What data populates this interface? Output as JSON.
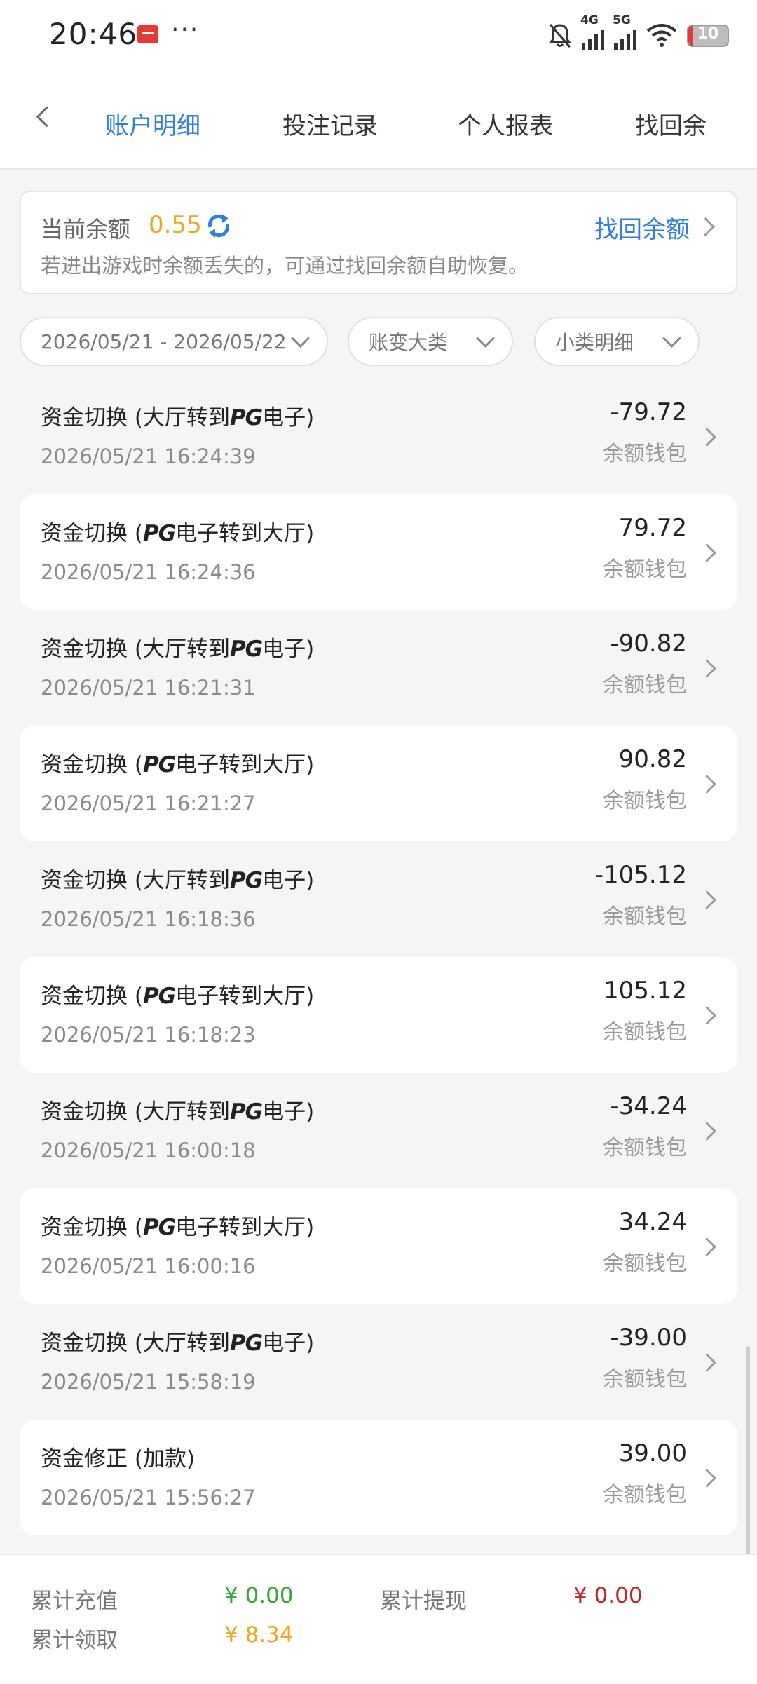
{
  "status_bar": {
    "time": "20:46",
    "more": "···",
    "network_4g": "4G",
    "network_5g": "5G",
    "battery": "10",
    "battery_level": 0.1,
    "icons": [
      "app-notification-icon",
      "bell-muted-icon",
      "signal-4g-icon",
      "signal-5g-icon",
      "wifi-icon",
      "battery-icon"
    ]
  },
  "tabs": [
    {
      "label": "账户明细",
      "active": true
    },
    {
      "label": "投注记录",
      "active": false
    },
    {
      "label": "个人报表",
      "active": false
    },
    {
      "label": "找回余",
      "active": false
    }
  ],
  "balance": {
    "label": "当前余额",
    "value": "0.55",
    "recover_label": "找回余额",
    "note": "若进出游戏时余额丢失的，可通过找回余额自助恢复。",
    "value_color": "#f0a623",
    "link_color": "#2f7fe0"
  },
  "filters": {
    "date_range": "2026/05/21 - 2026/05/22",
    "category": "账变大类",
    "subcategory": "小类明细"
  },
  "transactions": [
    {
      "prefix": "资金切换 (大厅转到",
      "pg": "PG",
      "suffix": "电子)",
      "time": "2026/05/21 16:24:39",
      "amount": "-79.72",
      "wallet": "余额钱包"
    },
    {
      "prefix": "资金切换 (",
      "pg": "PG",
      "suffix": "电子转到大厅)",
      "time": "2026/05/21 16:24:36",
      "amount": "79.72",
      "wallet": "余额钱包"
    },
    {
      "prefix": "资金切换 (大厅转到",
      "pg": "PG",
      "suffix": "电子)",
      "time": "2026/05/21 16:21:31",
      "amount": "-90.82",
      "wallet": "余额钱包"
    },
    {
      "prefix": "资金切换 (",
      "pg": "PG",
      "suffix": "电子转到大厅)",
      "time": "2026/05/21 16:21:27",
      "amount": "90.82",
      "wallet": "余额钱包"
    },
    {
      "prefix": "资金切换 (大厅转到",
      "pg": "PG",
      "suffix": "电子)",
      "time": "2026/05/21 16:18:36",
      "amount": "-105.12",
      "wallet": "余额钱包"
    },
    {
      "prefix": "资金切换 (",
      "pg": "PG",
      "suffix": "电子转到大厅)",
      "time": "2026/05/21 16:18:23",
      "amount": "105.12",
      "wallet": "余额钱包"
    },
    {
      "prefix": "资金切换 (大厅转到",
      "pg": "PG",
      "suffix": "电子)",
      "time": "2026/05/21 16:00:18",
      "amount": "-34.24",
      "wallet": "余额钱包"
    },
    {
      "prefix": "资金切换 (",
      "pg": "PG",
      "suffix": "电子转到大厅)",
      "time": "2026/05/21 16:00:16",
      "amount": "34.24",
      "wallet": "余额钱包"
    },
    {
      "prefix": "资金切换 (大厅转到",
      "pg": "PG",
      "suffix": "电子)",
      "time": "2026/05/21 15:58:19",
      "amount": "-39.00",
      "wallet": "余额钱包"
    },
    {
      "prefix": "资金修正 (加款)",
      "pg": "",
      "suffix": "",
      "time": "2026/05/21 15:56:27",
      "amount": "39.00",
      "wallet": "余额钱包"
    }
  ],
  "footer": {
    "deposit_label": "累计充值",
    "deposit_value": "¥ 0.00",
    "withdraw_label": "累计提现",
    "withdraw_value": "¥ 0.00",
    "claim_label": "累计领取",
    "claim_value": "¥ 8.34",
    "deposit_color": "#3aa63a",
    "withdraw_color": "#c0272d",
    "claim_color": "#f0a623"
  }
}
